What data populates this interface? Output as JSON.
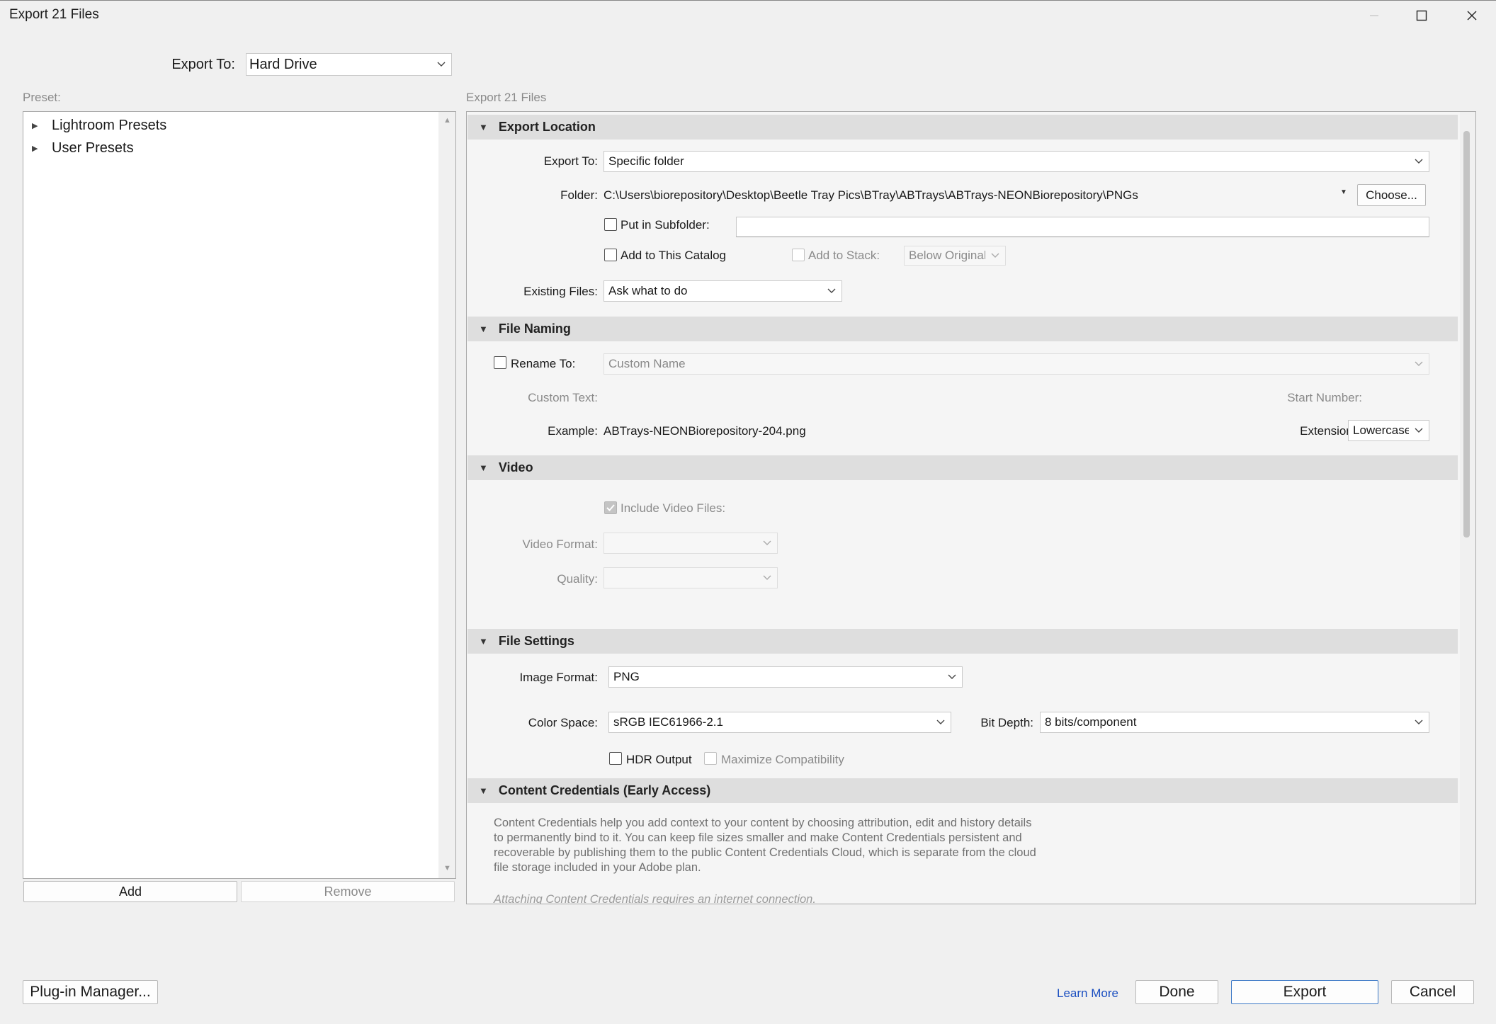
{
  "window": {
    "title": "Export 21 Files"
  },
  "top": {
    "export_to_label": "Export To:",
    "export_to_value": "Hard Drive"
  },
  "presets": {
    "label": "Preset:",
    "items": [
      {
        "label": "Lightroom Presets"
      },
      {
        "label": "User Presets"
      }
    ],
    "add_label": "Add",
    "remove_label": "Remove"
  },
  "main": {
    "header_label": "Export 21 Files",
    "export_location": {
      "title": "Export Location",
      "export_to_label": "Export To:",
      "export_to_value": "Specific folder",
      "folder_label": "Folder:",
      "folder_path": "C:\\Users\\biorepository\\Desktop\\Beetle Tray Pics\\BTray\\ABTrays\\ABTrays-NEONBiorepository\\PNGs",
      "choose_label": "Choose...",
      "subfolder_label": "Put in Subfolder:",
      "subfolder_value": "",
      "add_catalog_label": "Add to This Catalog",
      "add_stack_label": "Add to Stack:",
      "stack_value": "Below Original",
      "existing_label": "Existing Files:",
      "existing_value": "Ask what to do"
    },
    "file_naming": {
      "title": "File Naming",
      "rename_label": "Rename To:",
      "rename_value": "Custom Name",
      "custom_text_label": "Custom Text:",
      "start_number_label": "Start Number:",
      "example_label": "Example:",
      "example_value": "ABTrays-NEONBiorepository-204.png",
      "extensions_label": "Extensions:",
      "extensions_value": "Lowercase"
    },
    "video": {
      "title": "Video",
      "include_label": "Include Video Files:",
      "format_label": "Video Format:",
      "quality_label": "Quality:"
    },
    "file_settings": {
      "title": "File Settings",
      "format_label": "Image Format:",
      "format_value": "PNG",
      "color_space_label": "Color Space:",
      "color_space_value": "sRGB IEC61966-2.1",
      "bit_depth_label": "Bit Depth:",
      "bit_depth_value": "8 bits/component",
      "hdr_label": "HDR Output",
      "max_compat_label": "Maximize Compatibility"
    },
    "content_credentials": {
      "title": "Content Credentials (Early Access)",
      "lines": [
        "Content Credentials help you add context to your content by choosing attribution, edit and history details",
        "to permanently bind to it. You can keep file sizes smaller and make Content Credentials persistent and",
        "recoverable by publishing them to the public Content Credentials Cloud, which is separate from the cloud",
        "file storage included in your Adobe plan."
      ],
      "note": "Attaching Content Credentials requires an internet connection."
    }
  },
  "footer": {
    "plugin_manager_label": "Plug-in Manager...",
    "learn_more_label": "Learn More",
    "done_label": "Done",
    "export_label": "Export",
    "cancel_label": "Cancel"
  },
  "colors": {
    "background": "#f0f0f0",
    "section_header": "#dedede",
    "primary_border": "#3c78c6",
    "link": "#1a4ec0"
  },
  "icons": [
    "minimize-icon",
    "maximize-icon",
    "close-icon",
    "chevron-down-icon",
    "disclosure-triangle-icon",
    "checkmark-icon"
  ]
}
